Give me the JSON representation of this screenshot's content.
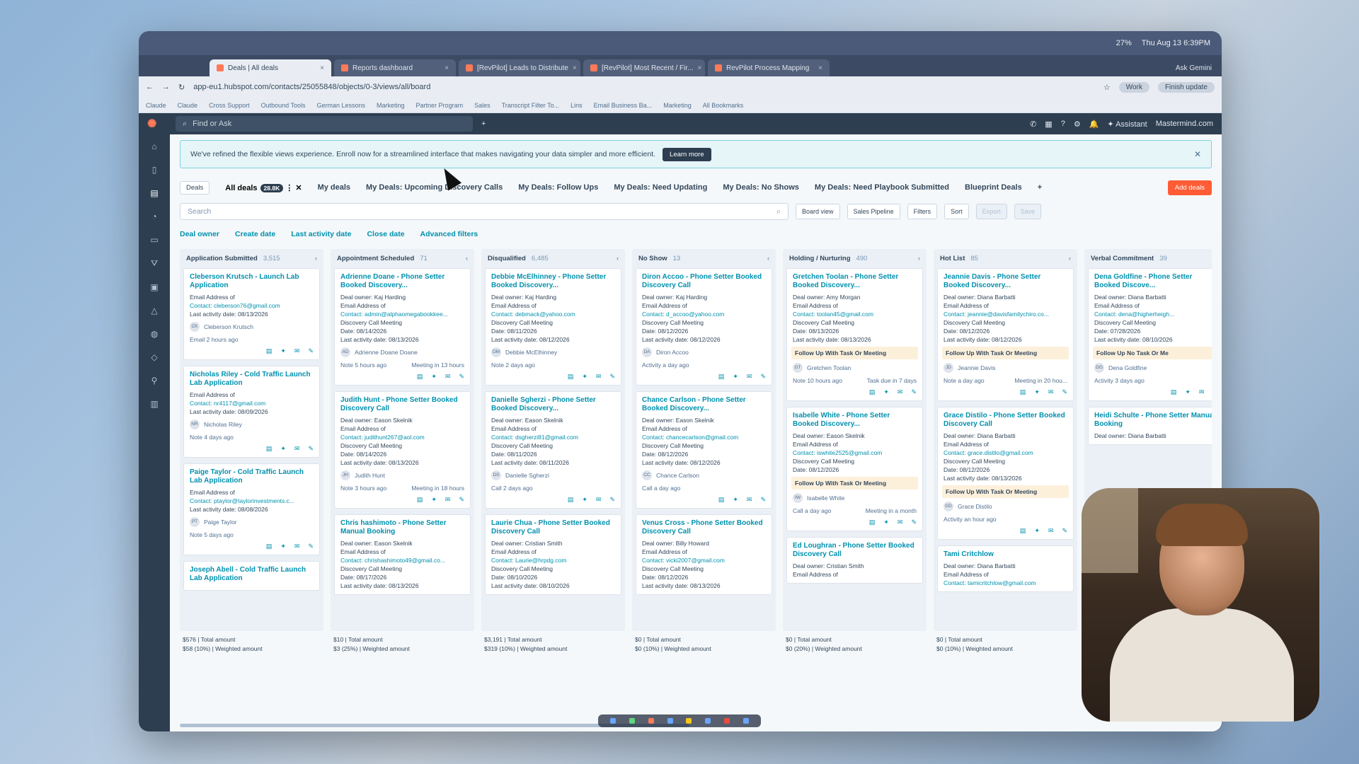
{
  "menubar": {
    "time": "Thu Aug 13  6:39PM",
    "battery": "27%"
  },
  "tabs": [
    {
      "label": "Deals | All deals",
      "active": true
    },
    {
      "label": "Reports dashboard",
      "active": false
    },
    {
      "label": "[RevPilot] Leads to Distribute",
      "active": false
    },
    {
      "label": "[RevPilot] Most Recent / Fir...",
      "active": false
    },
    {
      "label": "RevPilot Process Mapping",
      "active": false
    }
  ],
  "gemini": "Ask Gemini",
  "address": {
    "url": "app-eu1.hubspot.com/contacts/25055848/objects/0-3/views/all/board",
    "profile": "Work",
    "update": "Finish update"
  },
  "bookmarks": [
    "Claude",
    "Claude",
    "Cross Support",
    "Outbound Tools",
    "German Lessons",
    "Marketing",
    "Partner Program",
    "Sales",
    "Transcript Filter To...",
    "Lins",
    "Email Business Ba...",
    "Marketing",
    "All Bookmarks"
  ],
  "hs": {
    "search_placeholder": "Find or Ask",
    "assistant": "Assistant",
    "account": "Mastermind.com"
  },
  "banner": {
    "text": "We've refined the flexible views experience. Enroll now for a streamlined interface that makes navigating your data simpler and more efficient.",
    "button": "Learn more"
  },
  "views": {
    "object": "Deals",
    "all": "All deals",
    "count": "28.8K",
    "items": [
      "My deals",
      "My Deals: Upcoming Discovery Calls",
      "My Deals: Follow Ups",
      "My Deals: Need Updating",
      "My Deals: No Shows",
      "My Deals: Need Playbook Submitted",
      "Blueprint Deals"
    ],
    "add": "Add deals"
  },
  "toolbar": {
    "search_placeholder": "Search",
    "board_view": "Board view",
    "pipeline": "Sales Pipeline",
    "filters": "Filters",
    "sort": "Sort",
    "export": "Export",
    "save": "Save"
  },
  "filters": [
    "Deal owner",
    "Create date",
    "Last activity date",
    "Close date",
    "Advanced filters"
  ],
  "columns": [
    {
      "name": "Application Submitted",
      "count": "3,515",
      "total": "$576 | Total amount",
      "weighted": "$58 (10%) | Weighted amount",
      "cards": [
        {
          "title": "Cleberson Krutsch - Launch Lab Application",
          "lines": [
            "Email Address of",
            "Contact: cleberson76@gmail.com",
            "Last activity date: 08/13/2026"
          ],
          "ini": "CK",
          "contact": "Cleberson Krutsch",
          "note": "Email 2 hours ago",
          "note2": ""
        },
        {
          "title": "Nicholas Riley - Cold Traffic Launch Lab Application",
          "lines": [
            "Email Address of",
            "Contact: nr4117@gmail.com",
            "Last activity date: 08/09/2026"
          ],
          "ini": "NR",
          "contact": "Nicholas Riley",
          "note": "Note 4 days ago",
          "note2": ""
        },
        {
          "title": "Paige Taylor - Cold Traffic Launch Lab Application",
          "lines": [
            "Email Address of",
            "Contact: ptaylor@taylorinvestments.c...",
            "Last activity date: 08/08/2026"
          ],
          "ini": "PT",
          "contact": "Paige Taylor",
          "note": "Note 5 days ago",
          "note2": ""
        },
        {
          "title": "Joseph Abell - Cold Traffic Launch Lab Application",
          "lines": [],
          "ini": "",
          "contact": "",
          "note": "",
          "note2": ""
        }
      ]
    },
    {
      "name": "Appointment Scheduled",
      "count": "71",
      "total": "$10 | Total amount",
      "weighted": "$3 (25%) | Weighted amount",
      "cards": [
        {
          "title": "Adrienne Doane - Phone Setter Booked Discovery...",
          "lines": [
            "Deal owner: Kaj Harding",
            "Email Address of",
            "Contact: admin@alphaomegabookkee...",
            "Discovery Call Meeting",
            "Date: 08/14/2026",
            "Last activity date: 08/13/2026"
          ],
          "ini": "AD",
          "contact": "Adrienne Doane Doane",
          "note": "Note 5 hours ago",
          "note2": "Meeting in 13 hours"
        },
        {
          "title": "Judith Hunt - Phone Setter Booked Discovery Call",
          "lines": [
            "Deal owner: Eason Skelnik",
            "Email Address of",
            "Contact: judithunt267@aol.com",
            "Discovery Call Meeting",
            "Date: 08/14/2026",
            "Last activity date: 08/13/2026"
          ],
          "ini": "JH",
          "contact": "Judith Hunt",
          "note": "Note 3 hours ago",
          "note2": "Meeting in 18 hours"
        },
        {
          "title": "Chris hashimoto - Phone Setter Manual Booking",
          "lines": [
            "Deal owner: Eason Skelnik",
            "Email Address of",
            "Contact: chrishashimoto49@gmail.co...",
            "Discovery Call Meeting",
            "Date: 08/17/2026",
            "Last activity date: 08/13/2026"
          ],
          "ini": "",
          "contact": "",
          "note": "",
          "note2": ""
        }
      ]
    },
    {
      "name": "Disqualified",
      "count": "6,485",
      "total": "$3,191 | Total amount",
      "weighted": "$319 (10%) | Weighted amount",
      "cards": [
        {
          "title": "Debbie McElhinney - Phone Setter Booked Discovery...",
          "lines": [
            "Deal owner: Kaj Harding",
            "Email Address of",
            "Contact: debmack@yahoo.com",
            "Discovery Call Meeting",
            "Date: 08/11/2026",
            "Last activity date: 08/12/2026"
          ],
          "ini": "DM",
          "contact": "Debbie McElhinney",
          "note": "Note 2 days ago",
          "note2": ""
        },
        {
          "title": "Danielle Sgherzi - Phone Setter Booked Discovery...",
          "lines": [
            "Deal owner: Eason Skelnik",
            "Email Address of",
            "Contact: dsgherzi81@gmail.com",
            "Discovery Call Meeting",
            "Date: 08/11/2026",
            "Last activity date: 08/11/2026"
          ],
          "ini": "DS",
          "contact": "Danielle Sgherzi",
          "note": "Call 2 days ago",
          "note2": ""
        },
        {
          "title": "Laurie Chua - Phone Setter Booked Discovery Call",
          "lines": [
            "Deal owner: Cristian Smith",
            "Email Address of",
            "Contact: Laurie@hrpdg.com",
            "Discovery Call Meeting",
            "Date: 08/10/2026",
            "Last activity date: 08/10/2026"
          ],
          "ini": "",
          "contact": "",
          "note": "",
          "note2": ""
        }
      ]
    },
    {
      "name": "No Show",
      "count": "13",
      "total": "$0 | Total amount",
      "weighted": "$0 (10%) | Weighted amount",
      "cards": [
        {
          "title": "Diron Accoo - Phone Setter Booked Discovery Call",
          "lines": [
            "Deal owner: Kaj Harding",
            "Email Address of",
            "Contact: d_accoo@yahoo.com",
            "Discovery Call Meeting",
            "Date: 08/12/2026",
            "Last activity date: 08/12/2026"
          ],
          "ini": "DA",
          "contact": "Diron Accoo",
          "note": "Activity a day ago",
          "note2": ""
        },
        {
          "title": "Chance Carlson - Phone Setter Booked Discovery...",
          "lines": [
            "Deal owner: Eason Skelnik",
            "Email Address of",
            "Contact: chancecarlson@gmail.com",
            "Discovery Call Meeting",
            "Date: 08/12/2026",
            "Last activity date: 08/12/2026"
          ],
          "ini": "CC",
          "contact": "Chance Carlson",
          "note": "Call a day ago",
          "note2": ""
        },
        {
          "title": "Venus Cross - Phone Setter Booked Discovery Call",
          "lines": [
            "Deal owner: Billy Howard",
            "Email Address of",
            "Contact: vicki2007@gmail.com",
            "Discovery Call Meeting",
            "Date: 08/12/2026",
            "Last activity date: 08/13/2026"
          ],
          "ini": "",
          "contact": "",
          "note": "",
          "note2": ""
        }
      ]
    },
    {
      "name": "Holding / Nurturing",
      "count": "490",
      "total": "$0 | Total amount",
      "weighted": "$0 (20%) | Weighted amount",
      "cards": [
        {
          "title": "Gretchen Toolan - Phone Setter Booked Discovery...",
          "lines": [
            "Deal owner: Amy Morgan",
            "Email Address of",
            "Contact: toolan45@gmail.com",
            "Discovery Call Meeting",
            "Date: 08/13/2026",
            "Last activity date: 08/13/2026"
          ],
          "tag": "Follow Up With Task Or Meeting",
          "ini": "GT",
          "contact": "Gretchen Toolan",
          "note": "Note 10 hours ago",
          "note2": "Task due in 7 days"
        },
        {
          "title": "Isabelle White - Phone Setter Booked Discovery...",
          "lines": [
            "Deal owner: Eason Skelnik",
            "Email Address of",
            "Contact: iswhite2525@gmail.com",
            "Discovery Call Meeting",
            "Date: 08/12/2026"
          ],
          "tag": "Follow Up With Task Or Meeting",
          "ini": "IW",
          "contact": "Isabelle White",
          "note": "Call a day ago",
          "note2": "Meeting in a month"
        },
        {
          "title": "Ed Loughran - Phone Setter Booked Discovery Call",
          "lines": [
            "Deal owner: Cristian Smith",
            "Email Address of"
          ],
          "ini": "",
          "contact": "",
          "note": "",
          "note2": ""
        }
      ]
    },
    {
      "name": "Hot List",
      "count": "85",
      "total": "$0 | Total amount",
      "weighted": "$0 (10%) | Weighted amount",
      "cards": [
        {
          "title": "Jeannie Davis - Phone Setter Booked Discovery...",
          "lines": [
            "Deal owner: Diana Barbatti",
            "Email Address of",
            "Contact: jeannie@davisfamilychiro.co...",
            "Discovery Call Meeting",
            "Date: 08/12/2026",
            "Last activity date: 08/12/2026"
          ],
          "tag": "Follow Up With Task Or Meeting",
          "ini": "JD",
          "contact": "Jeannie Davis",
          "note": "Note a day ago",
          "note2": "Meeting in 20 hou..."
        },
        {
          "title": "Grace Distilo - Phone Setter Booked Discovery Call",
          "lines": [
            "Deal owner: Diana Barbatti",
            "Email Address of",
            "Contact: grace.distilo@gmail.com",
            "Discovery Call Meeting",
            "Date: 08/12/2026",
            "Last activity date: 08/13/2026"
          ],
          "tag": "Follow Up With Task Or Meeting",
          "ini": "GD",
          "contact": "Grace Distilo",
          "note": "Activity an hour ago",
          "note2": ""
        },
        {
          "title": "Tami Critchlow",
          "lines": [
            "Deal owner: Diana Barbatti",
            "Email Address of",
            "Contact: tamicritchlow@gmail.com"
          ],
          "ini": "",
          "contact": "",
          "note": "",
          "note2": ""
        }
      ]
    },
    {
      "name": "Verbal Commitment",
      "count": "39",
      "total": "",
      "weighted": "",
      "cards": [
        {
          "title": "Dena Goldfine - Phone Setter Booked Discove...",
          "lines": [
            "Deal owner: Diana Barbatti",
            "Email Address of",
            "Contact: dena@higherheigh...",
            "Discovery Call Meeting",
            "Date: 07/28/2026",
            "Last activity date: 08/10/2026"
          ],
          "tag": "Follow Up No Task Or Me",
          "ini": "DG",
          "contact": "Dena Goldfine",
          "note": "Activity 3 days ago",
          "note2": ""
        },
        {
          "title": "Heidi Schulte - Phone Setter Manual Booking",
          "lines": [
            "Deal owner: Diana Barbatti"
          ],
          "ini": "",
          "contact": "",
          "note": "",
          "note2": ""
        }
      ]
    }
  ],
  "colors": {
    "accent": "#ff7a59",
    "link": "#0091ae",
    "nav": "#2d3e50"
  }
}
